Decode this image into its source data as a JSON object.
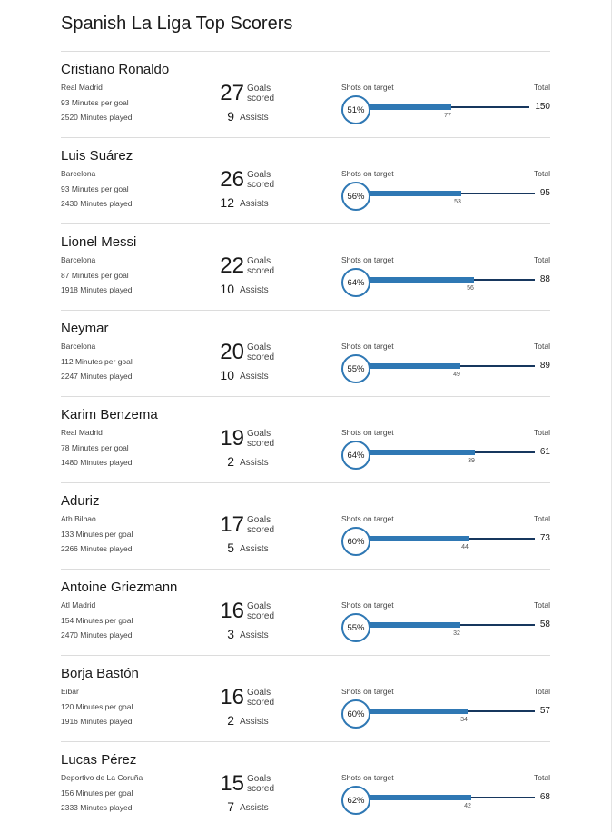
{
  "title": "Spanish La Liga Top Scorers",
  "labels": {
    "minutes_per_goal": "Minutes per goal",
    "minutes_played": "Minutes played",
    "goals": "Goals scored",
    "assists": "Assists",
    "shots_on_target": "Shots on target",
    "total": "Total"
  },
  "colors": {
    "accent": "#2f78b4",
    "track": "#17375e",
    "rule": "#dcdcdc"
  },
  "players": [
    {
      "name": "Cristiano Ronaldo",
      "team": "Real Madrid",
      "minutes_per_goal": 93,
      "minutes_played": 2520,
      "goals": 27,
      "assists": 9,
      "pct": "51%",
      "on_target": 77,
      "total": 150
    },
    {
      "name": "Luis Suárez",
      "team": "Barcelona",
      "minutes_per_goal": 93,
      "minutes_played": 2430,
      "goals": 26,
      "assists": 12,
      "pct": "56%",
      "on_target": 53,
      "total": 95
    },
    {
      "name": "Lionel Messi",
      "team": "Barcelona",
      "minutes_per_goal": 87,
      "minutes_played": 1918,
      "goals": 22,
      "assists": 10,
      "pct": "64%",
      "on_target": 56,
      "total": 88
    },
    {
      "name": "Neymar",
      "team": "Barcelona",
      "minutes_per_goal": 112,
      "minutes_played": 2247,
      "goals": 20,
      "assists": 10,
      "pct": "55%",
      "on_target": 49,
      "total": 89
    },
    {
      "name": "Karim Benzema",
      "team": "Real Madrid",
      "minutes_per_goal": 78,
      "minutes_played": 1480,
      "goals": 19,
      "assists": 2,
      "pct": "64%",
      "on_target": 39,
      "total": 61
    },
    {
      "name": "Aduriz",
      "team": "Ath Bilbao",
      "minutes_per_goal": 133,
      "minutes_played": 2266,
      "goals": 17,
      "assists": 5,
      "pct": "60%",
      "on_target": 44,
      "total": 73
    },
    {
      "name": "Antoine Griezmann",
      "team": "Atl Madrid",
      "minutes_per_goal": 154,
      "minutes_played": 2470,
      "goals": 16,
      "assists": 3,
      "pct": "55%",
      "on_target": 32,
      "total": 58
    },
    {
      "name": "Borja Bastón",
      "team": "Eibar",
      "minutes_per_goal": 120,
      "minutes_played": 1916,
      "goals": 16,
      "assists": 2,
      "pct": "60%",
      "on_target": 34,
      "total": 57
    },
    {
      "name": "Lucas Pérez",
      "team": "Deportivo de La Coruña",
      "minutes_per_goal": 156,
      "minutes_played": 2333,
      "goals": 15,
      "assists": 7,
      "pct": "62%",
      "on_target": 42,
      "total": 68
    }
  ]
}
